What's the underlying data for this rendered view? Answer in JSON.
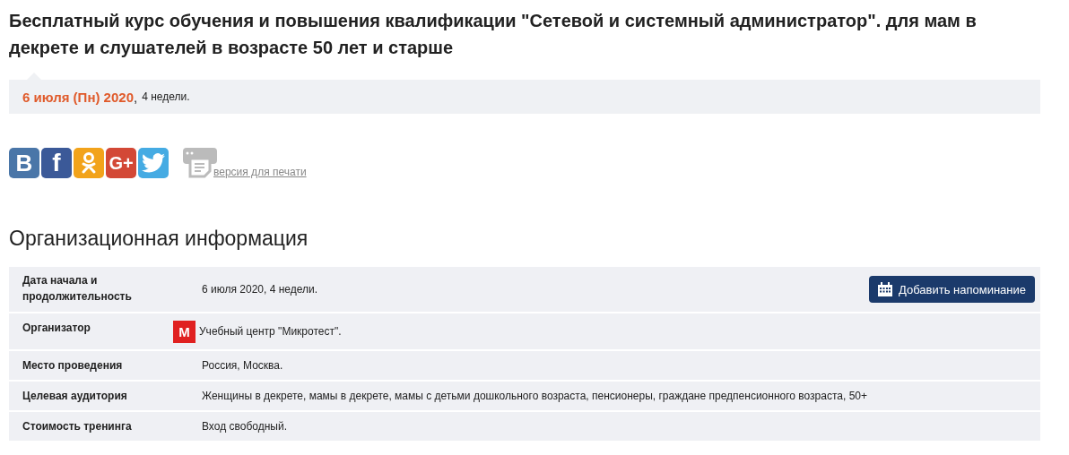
{
  "title": "Бесплатный курс обучения и повышения квалификации \"Сетевой и системный администратор\". для мам в декрете и слушателей в возрасте 50 лет и старше",
  "date_panel": {
    "date": "6 июля (Пн) 2020",
    "separator": ",",
    "duration": "4 недели."
  },
  "share_buttons": [
    {
      "kind": "vk",
      "label": "В",
      "color": "#4a76a8"
    },
    {
      "kind": "facebook",
      "label": "f",
      "color": "#3b5998"
    },
    {
      "kind": "odnoklassniki",
      "color": "#f2a31b"
    },
    {
      "kind": "googleplus",
      "label": "G+",
      "color": "#d34836"
    },
    {
      "kind": "twitter",
      "color": "#45abe3"
    }
  ],
  "print_link": "версия для печати",
  "section_title": "Организационная информация",
  "info_rows": [
    {
      "label": "Дата начала и продолжительность",
      "value": "6 июля 2020, 4 недели.",
      "button": "Добавить напоминание"
    },
    {
      "label": "Организатор",
      "value": "Учебный центр \"Микротест\".",
      "logo": "М"
    },
    {
      "label": "Место проведения",
      "value": "Россия, Москва."
    },
    {
      "label": "Целевая аудитория",
      "value": "Женщины в декрете, мамы в декрете, мамы с детьми дошкольного возраста, пенсионеры, граждане предпенсионного возраста, 50+"
    },
    {
      "label": "Стоимость тренинга",
      "value": "Вход свободный."
    }
  ]
}
